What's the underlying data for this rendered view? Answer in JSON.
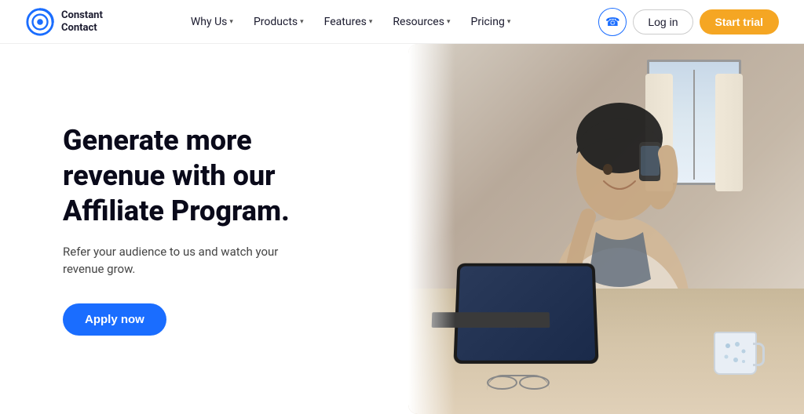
{
  "nav": {
    "logo": {
      "line1": "Constant",
      "line2": "Contact"
    },
    "links": [
      {
        "label": "Why Us",
        "hasDropdown": true
      },
      {
        "label": "Products",
        "hasDropdown": true
      },
      {
        "label": "Features",
        "hasDropdown": true
      },
      {
        "label": "Resources",
        "hasDropdown": true
      },
      {
        "label": "Pricing",
        "hasDropdown": true
      }
    ],
    "phone_icon": "☎",
    "login_label": "Log in",
    "trial_label": "Start trial"
  },
  "hero": {
    "heading": "Generate more revenue with our Affiliate Program.",
    "subtext": "Refer your audience to us and watch your revenue grow.",
    "cta_label": "Apply now"
  },
  "colors": {
    "brand_blue": "#1a6dff",
    "cta_orange": "#f5a623",
    "heading_dark": "#0a0a1a",
    "text_gray": "#444444"
  }
}
